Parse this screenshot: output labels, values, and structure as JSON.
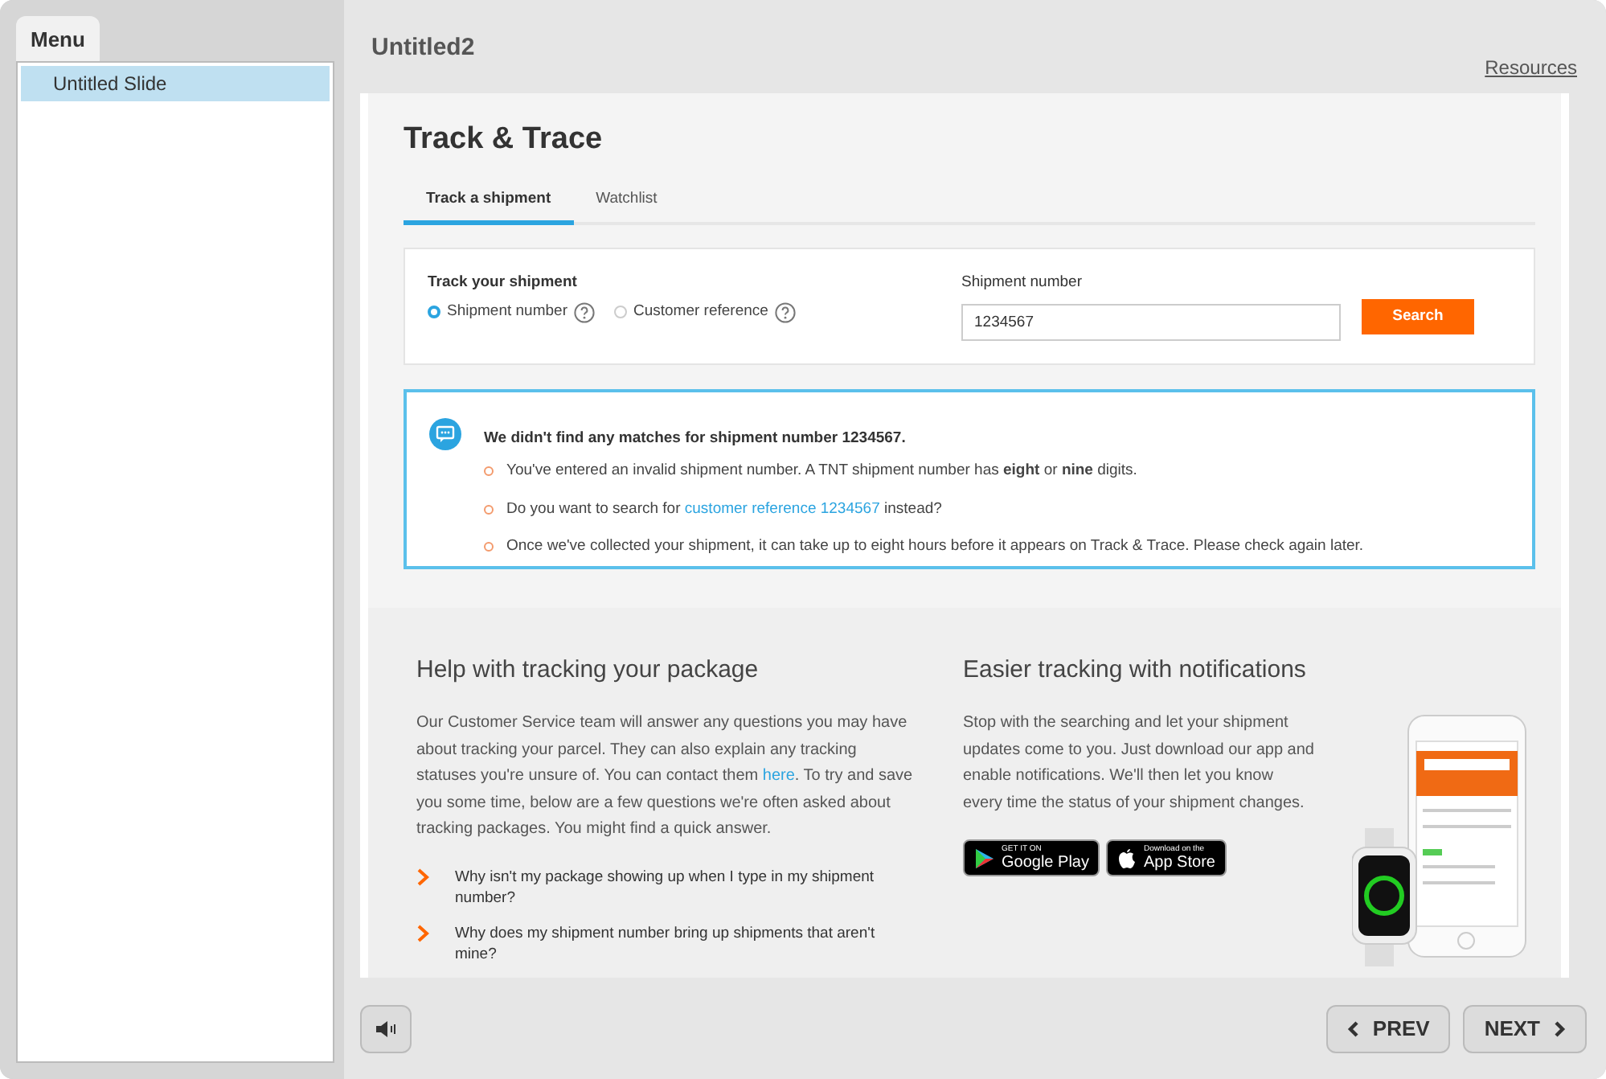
{
  "sidebar": {
    "tab": "Menu",
    "items": [
      {
        "label": "Untitled Slide",
        "selected": true
      }
    ]
  },
  "header": {
    "title": "Untitled2",
    "link": "Resources"
  },
  "slide": {
    "title": "Track & Trace",
    "tabs": [
      {
        "label": "Track a shipment",
        "selected": true
      },
      {
        "label": "Watchlist",
        "selected": false
      }
    ],
    "form": {
      "heading": "Track your shipment",
      "options": [
        {
          "label": "Shipment number",
          "selected": true
        },
        {
          "label": "Customer reference",
          "selected": false
        }
      ],
      "field_label": "Shipment number",
      "value": "1234567",
      "button": "Search"
    },
    "alert": {
      "heading": "We didn't find any matches for shipment number 1234567.",
      "items": [
        {
          "before": "You've entered an invalid shipment number. A TNT shipment number has **eight** or **nine** digits."
        },
        {
          "before": "Do you want to search for ",
          "link": "customer reference 1234567",
          "after": " instead?"
        },
        {
          "before": "Once we've collected your shipment, it can take up to eight hours before it appears on Track & Trace. Please check again later."
        }
      ]
    },
    "help": {
      "title": "Help with tracking your package",
      "before": "Our Customer Service team will answer any questions you may have about tracking your parcel. They can also explain any tracking statuses you're unsure of. You can contact them ",
      "link": "here",
      "after": ". To try and save you some time, below are a few questions we're often asked about tracking packages. You might find a quick answer.",
      "questions": [
        "Why isn't my package showing up when I type in my shipment number?",
        "Why does my shipment number bring up shipments that aren't mine?"
      ]
    },
    "notifications": {
      "title": "Easier tracking with notifications",
      "text": "Stop with the searching and let your shipment updates come to you. Just download our app and enable notifications. We'll then let you know every time the status of your shipment changes.",
      "badges": [
        {
          "kind": "google",
          "small": "GET IT ON",
          "big": "Google Play"
        },
        {
          "kind": "apple",
          "small": "Download on the",
          "big": "App Store"
        }
      ]
    }
  },
  "footer": {
    "prev": "PREV",
    "next": "NEXT"
  }
}
